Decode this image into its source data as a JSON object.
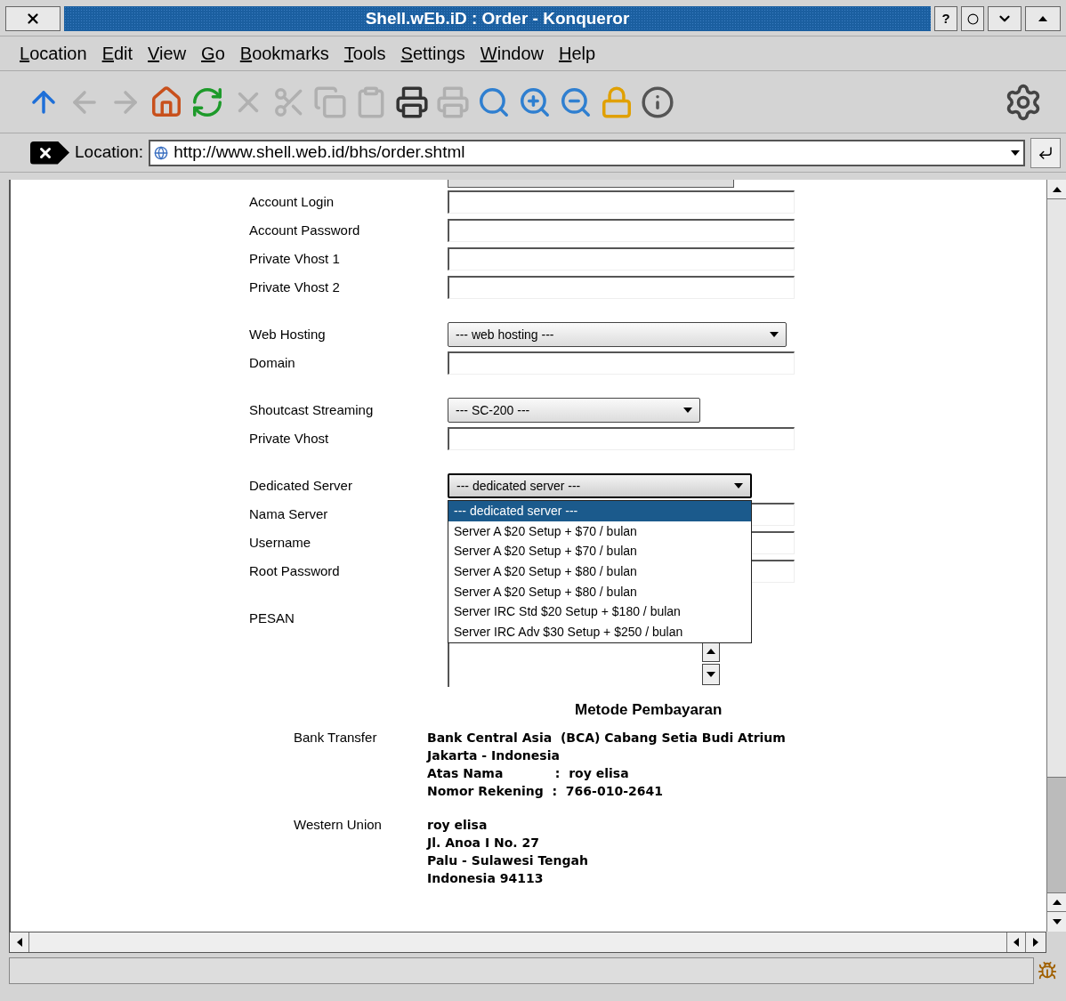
{
  "window": {
    "title": "Shell.wEb.iD : Order - Konqueror",
    "help_button": "?"
  },
  "menu": [
    "Location",
    "Edit",
    "View",
    "Go",
    "Bookmarks",
    "Tools",
    "Settings",
    "Window",
    "Help"
  ],
  "location_bar": {
    "label": "Location:",
    "url": "http://www.shell.web.id/bhs/order.shtml"
  },
  "form": {
    "groups": [
      {
        "fields": [
          {
            "kind": "text",
            "label": "Account Login"
          },
          {
            "kind": "text",
            "label": "Account Password"
          },
          {
            "kind": "text",
            "label": "Private Vhost 1"
          },
          {
            "kind": "text",
            "label": "Private Vhost 2"
          }
        ]
      },
      {
        "fields": [
          {
            "kind": "select",
            "label": "Web Hosting",
            "value": "--- web hosting ---"
          },
          {
            "kind": "text",
            "label": "Domain"
          }
        ]
      },
      {
        "fields": [
          {
            "kind": "select",
            "label": "Shoutcast Streaming",
            "value": "--- SC-200 ---"
          },
          {
            "kind": "text",
            "label": "Private Vhost"
          }
        ]
      },
      {
        "fields": [
          {
            "kind": "select",
            "label": "Dedicated Server",
            "value": "--- dedicated server ---",
            "expanded": true,
            "options": [
              {
                "label": "--- dedicated server ---",
                "selected": true
              },
              {
                "label": "Server A $20 Setup + $70 / bulan",
                "selected": false
              },
              {
                "label": "Server A $20 Setup + $70 / bulan",
                "selected": false
              },
              {
                "label": "Server A $20 Setup + $80 / bulan",
                "selected": false
              },
              {
                "label": "Server A $20 Setup + $80 / bulan",
                "selected": false
              },
              {
                "label": "Server IRC Std $20 Setup + $180 / bulan",
                "selected": false
              },
              {
                "label": "Server IRC Adv $30 Setup + $250 / bulan",
                "selected": false
              }
            ]
          },
          {
            "kind": "text",
            "label": "Nama Server"
          },
          {
            "kind": "text",
            "label": "Username"
          },
          {
            "kind": "text",
            "label": "Root Password"
          }
        ]
      },
      {
        "fields": [
          {
            "kind": "textarea",
            "label": "PESAN"
          }
        ]
      }
    ]
  },
  "payment": {
    "title": "Metode Pembayaran",
    "methods": [
      {
        "label": "Bank Transfer",
        "lines": [
          "Bank Central Asia  (BCA) Cabang Setia Budi Atrium",
          "Jakarta - Indonesia",
          "Atas Nama            :  roy elisa",
          "Nomor Rekening  :  766-010-2641"
        ]
      },
      {
        "label": "Western Union",
        "lines": [
          "roy elisa",
          "Jl. Anoa I No. 27",
          "Palu - Sulawesi Tengah",
          "Indonesia 94113"
        ]
      }
    ]
  }
}
